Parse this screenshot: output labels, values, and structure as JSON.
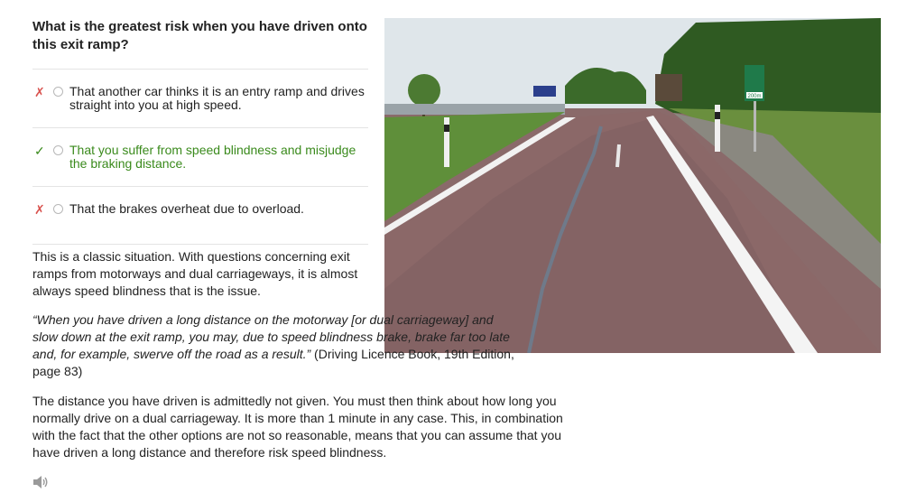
{
  "question": "What is the greatest risk when you have driven onto this exit ramp?",
  "options": [
    {
      "mark": "✗",
      "status": "wrong",
      "text": "That another car thinks it is an entry ramp and drives straight into you at high speed."
    },
    {
      "mark": "✓",
      "status": "correct",
      "text": "That you suffer from speed blindness and misjudge the braking distance."
    },
    {
      "mark": "✗",
      "status": "wrong",
      "text": "That the brakes overheat due to overload."
    }
  ],
  "explanation": {
    "p1": "This is a classic situation. With questions concerning exit ramps from motorways and dual carriageways, it is almost always speed blindness that is the issue.",
    "p2_quote": "“When you have driven a long distance on the motorway [or dual carriageway] and slow down at the exit ramp, you may, due to speed blindness brake, brake far too late and, for example, swerve off the road as a result.”",
    "p2_source": " (Driving Licence Book, 19th Edition, page 83)",
    "p3": "The distance you have driven is admittedly not given. You must then think about how long you normally drive on a dual carriageway. It is more than 1 minute in any case. This, in combination with the fact that the other options are not so reasonable, means that you can assume that you have driven a long distance and therefore risk speed blindness."
  },
  "image": {
    "sign_text": "200m"
  },
  "colors": {
    "correct": "#3a8a1c",
    "wrong": "#d9534f"
  },
  "icons": {
    "audio": "speaker-icon"
  }
}
